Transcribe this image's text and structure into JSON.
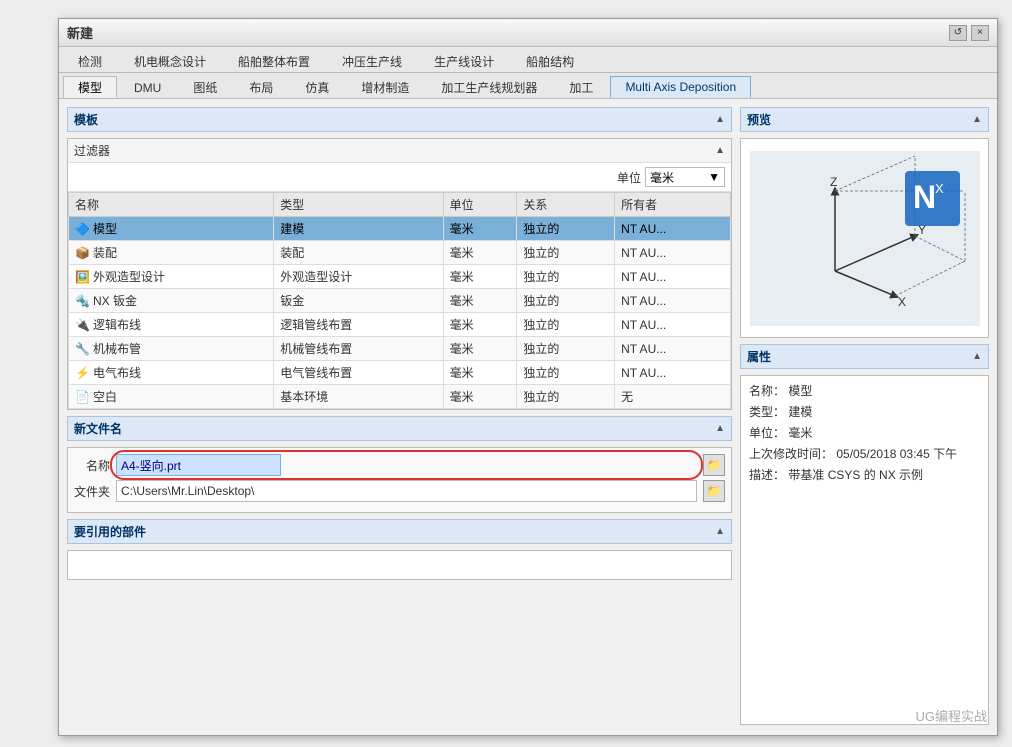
{
  "dialog": {
    "title": "新建",
    "close_btn": "×",
    "refresh_btn": "↺"
  },
  "tabs_row1": {
    "items": [
      {
        "label": "检测",
        "active": false
      },
      {
        "label": "机电概念设计",
        "active": false
      },
      {
        "label": "船舶整体布置",
        "active": false
      },
      {
        "label": "冲压生产线",
        "active": false
      },
      {
        "label": "生产线设计",
        "active": false
      },
      {
        "label": "船舶结构",
        "active": false
      }
    ]
  },
  "tabs_row2": {
    "items": [
      {
        "label": "模型",
        "active": true
      },
      {
        "label": "DMU",
        "active": false
      },
      {
        "label": "图纸",
        "active": false
      },
      {
        "label": "布局",
        "active": false
      },
      {
        "label": "仿真",
        "active": false
      },
      {
        "label": "增材制造",
        "active": false
      },
      {
        "label": "加工生产线规划器",
        "active": false
      },
      {
        "label": "加工",
        "active": false
      },
      {
        "label": "Multi Axis Deposition",
        "active": false
      }
    ]
  },
  "template_section": {
    "header": "模板",
    "filter_label": "过滤器",
    "unit_label": "单位",
    "unit_value": "毫米",
    "columns": [
      "名称",
      "类型",
      "单位",
      "关系",
      "所有者"
    ],
    "rows": [
      {
        "icon": "model-icon",
        "name": "模型",
        "type": "建模",
        "unit": "毫米",
        "relation": "独立的",
        "owner": "NT AU...",
        "selected": true
      },
      {
        "icon": "assembly-icon",
        "name": "装配",
        "type": "装配",
        "unit": "毫米",
        "relation": "独立的",
        "owner": "NT AU...",
        "selected": false
      },
      {
        "icon": "shape-icon",
        "name": "外观造型设计",
        "type": "外观造型设计",
        "unit": "毫米",
        "relation": "独立的",
        "owner": "NT AU...",
        "selected": false
      },
      {
        "icon": "sheetmetal-icon",
        "name": "NX 钣金",
        "type": "钣金",
        "unit": "毫米",
        "relation": "独立的",
        "owner": "NT AU...",
        "selected": false
      },
      {
        "icon": "routing-logic-icon",
        "name": "逻辑布线",
        "type": "逻辑管线布置",
        "unit": "毫米",
        "relation": "独立的",
        "owner": "NT AU...",
        "selected": false
      },
      {
        "icon": "routing-mech-icon",
        "name": "机械布管",
        "type": "机械管线布置",
        "unit": "毫米",
        "relation": "独立的",
        "owner": "NT AU...",
        "selected": false
      },
      {
        "icon": "routing-elec-icon",
        "name": "电气布线",
        "type": "电气管线布置",
        "unit": "毫米",
        "relation": "独立的",
        "owner": "NT AU...",
        "selected": false
      },
      {
        "icon": "blank-icon",
        "name": "空白",
        "type": "基本环境",
        "unit": "毫米",
        "relation": "独立的",
        "owner": "无",
        "selected": false
      }
    ]
  },
  "new_filename": {
    "header": "新文件名",
    "name_label": "名称",
    "folder_label": "文件夹",
    "name_value": "A4-竖向.prt",
    "folder_value": "C:\\Users\\Mr.Lin\\Desktop\\"
  },
  "ref_parts": {
    "header": "要引用的部件"
  },
  "preview": {
    "header": "预览"
  },
  "properties": {
    "header": "属性",
    "name_label": "名称：",
    "name_value": "模型",
    "type_label": "类型：",
    "type_value": "建模",
    "unit_label": "单位：",
    "unit_value": "毫米",
    "modified_label": "上次修改时间：",
    "modified_value": "05/05/2018 03:45 下午",
    "desc_label": "描述：",
    "desc_value": "带基准 CSYS 的 NX 示例"
  },
  "watermark": "UG编程实战"
}
